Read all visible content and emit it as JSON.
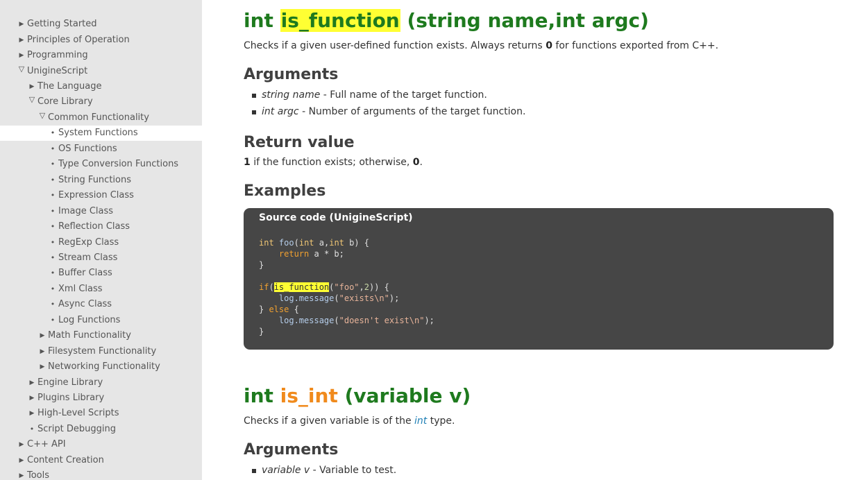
{
  "sidebar": {
    "items": [
      {
        "label": "Getting Started",
        "marker": "▶"
      },
      {
        "label": "Principles of Operation",
        "marker": "▶"
      },
      {
        "label": "Programming",
        "marker": "▶"
      },
      {
        "label": "UnigineScript",
        "marker": "▽"
      },
      {
        "label": "The Language",
        "marker": "▶"
      },
      {
        "label": "Core Library",
        "marker": "▽"
      },
      {
        "label": "Common Functionality",
        "marker": "▽"
      },
      {
        "label": "System Functions",
        "marker": "•"
      },
      {
        "label": "OS Functions",
        "marker": "•"
      },
      {
        "label": "Type Conversion Functions",
        "marker": "•"
      },
      {
        "label": "String Functions",
        "marker": "•"
      },
      {
        "label": "Expression Class",
        "marker": "•"
      },
      {
        "label": "Image Class",
        "marker": "•"
      },
      {
        "label": "Reflection Class",
        "marker": "•"
      },
      {
        "label": "RegExp Class",
        "marker": "•"
      },
      {
        "label": "Stream Class",
        "marker": "•"
      },
      {
        "label": "Buffer Class",
        "marker": "•"
      },
      {
        "label": "Xml Class",
        "marker": "•"
      },
      {
        "label": "Async Class",
        "marker": "•"
      },
      {
        "label": "Log Functions",
        "marker": "•"
      },
      {
        "label": "Math Functionality",
        "marker": "▶"
      },
      {
        "label": "Filesystem Functionality",
        "marker": "▶"
      },
      {
        "label": "Networking Functionality",
        "marker": "▶"
      },
      {
        "label": "Engine Library",
        "marker": "▶"
      },
      {
        "label": "Plugins Library",
        "marker": "▶"
      },
      {
        "label": "High-Level Scripts",
        "marker": "▶"
      },
      {
        "label": "Script Debugging",
        "marker": "•"
      },
      {
        "label": "C++ API",
        "marker": "▶"
      },
      {
        "label": "Content Creation",
        "marker": "▶"
      },
      {
        "label": "Tools",
        "marker": "▶"
      }
    ]
  },
  "section1": {
    "ret_type": "int",
    "name": "is_function",
    "params": "(string name,int argc)",
    "desc_pre": "Checks if a given user-defined function exists. Always returns ",
    "desc_bold": "0",
    "desc_post": " for functions exported from C++.",
    "arguments_heading": "Arguments",
    "args": [
      {
        "name": "string name",
        "desc": " - Full name of the target function."
      },
      {
        "name": "int argc",
        "desc": " - Number of arguments of the target function."
      }
    ],
    "return_heading": "Return value",
    "return_bold_1": "1",
    "return_mid": " if the function exists; otherwise, ",
    "return_bold_2": "0",
    "return_end": ".",
    "examples_heading": "Examples",
    "code_title": "Source code (UnigineScript)"
  },
  "section2": {
    "ret_type": "int",
    "name": "is_int",
    "params": "(variable v)",
    "desc_pre": "Checks if a given variable is of the ",
    "desc_link": "int",
    "desc_post": " type.",
    "arguments_heading": "Arguments",
    "args": [
      {
        "name": "variable v",
        "desc": " - Variable to test."
      }
    ]
  },
  "colors": {
    "title_green": "#1e7a1e",
    "highlight_yellow": "#ffff33",
    "accent_orange": "#f08a1c",
    "sidebar_bg": "#e6e6e6",
    "code_bg": "#464646"
  }
}
